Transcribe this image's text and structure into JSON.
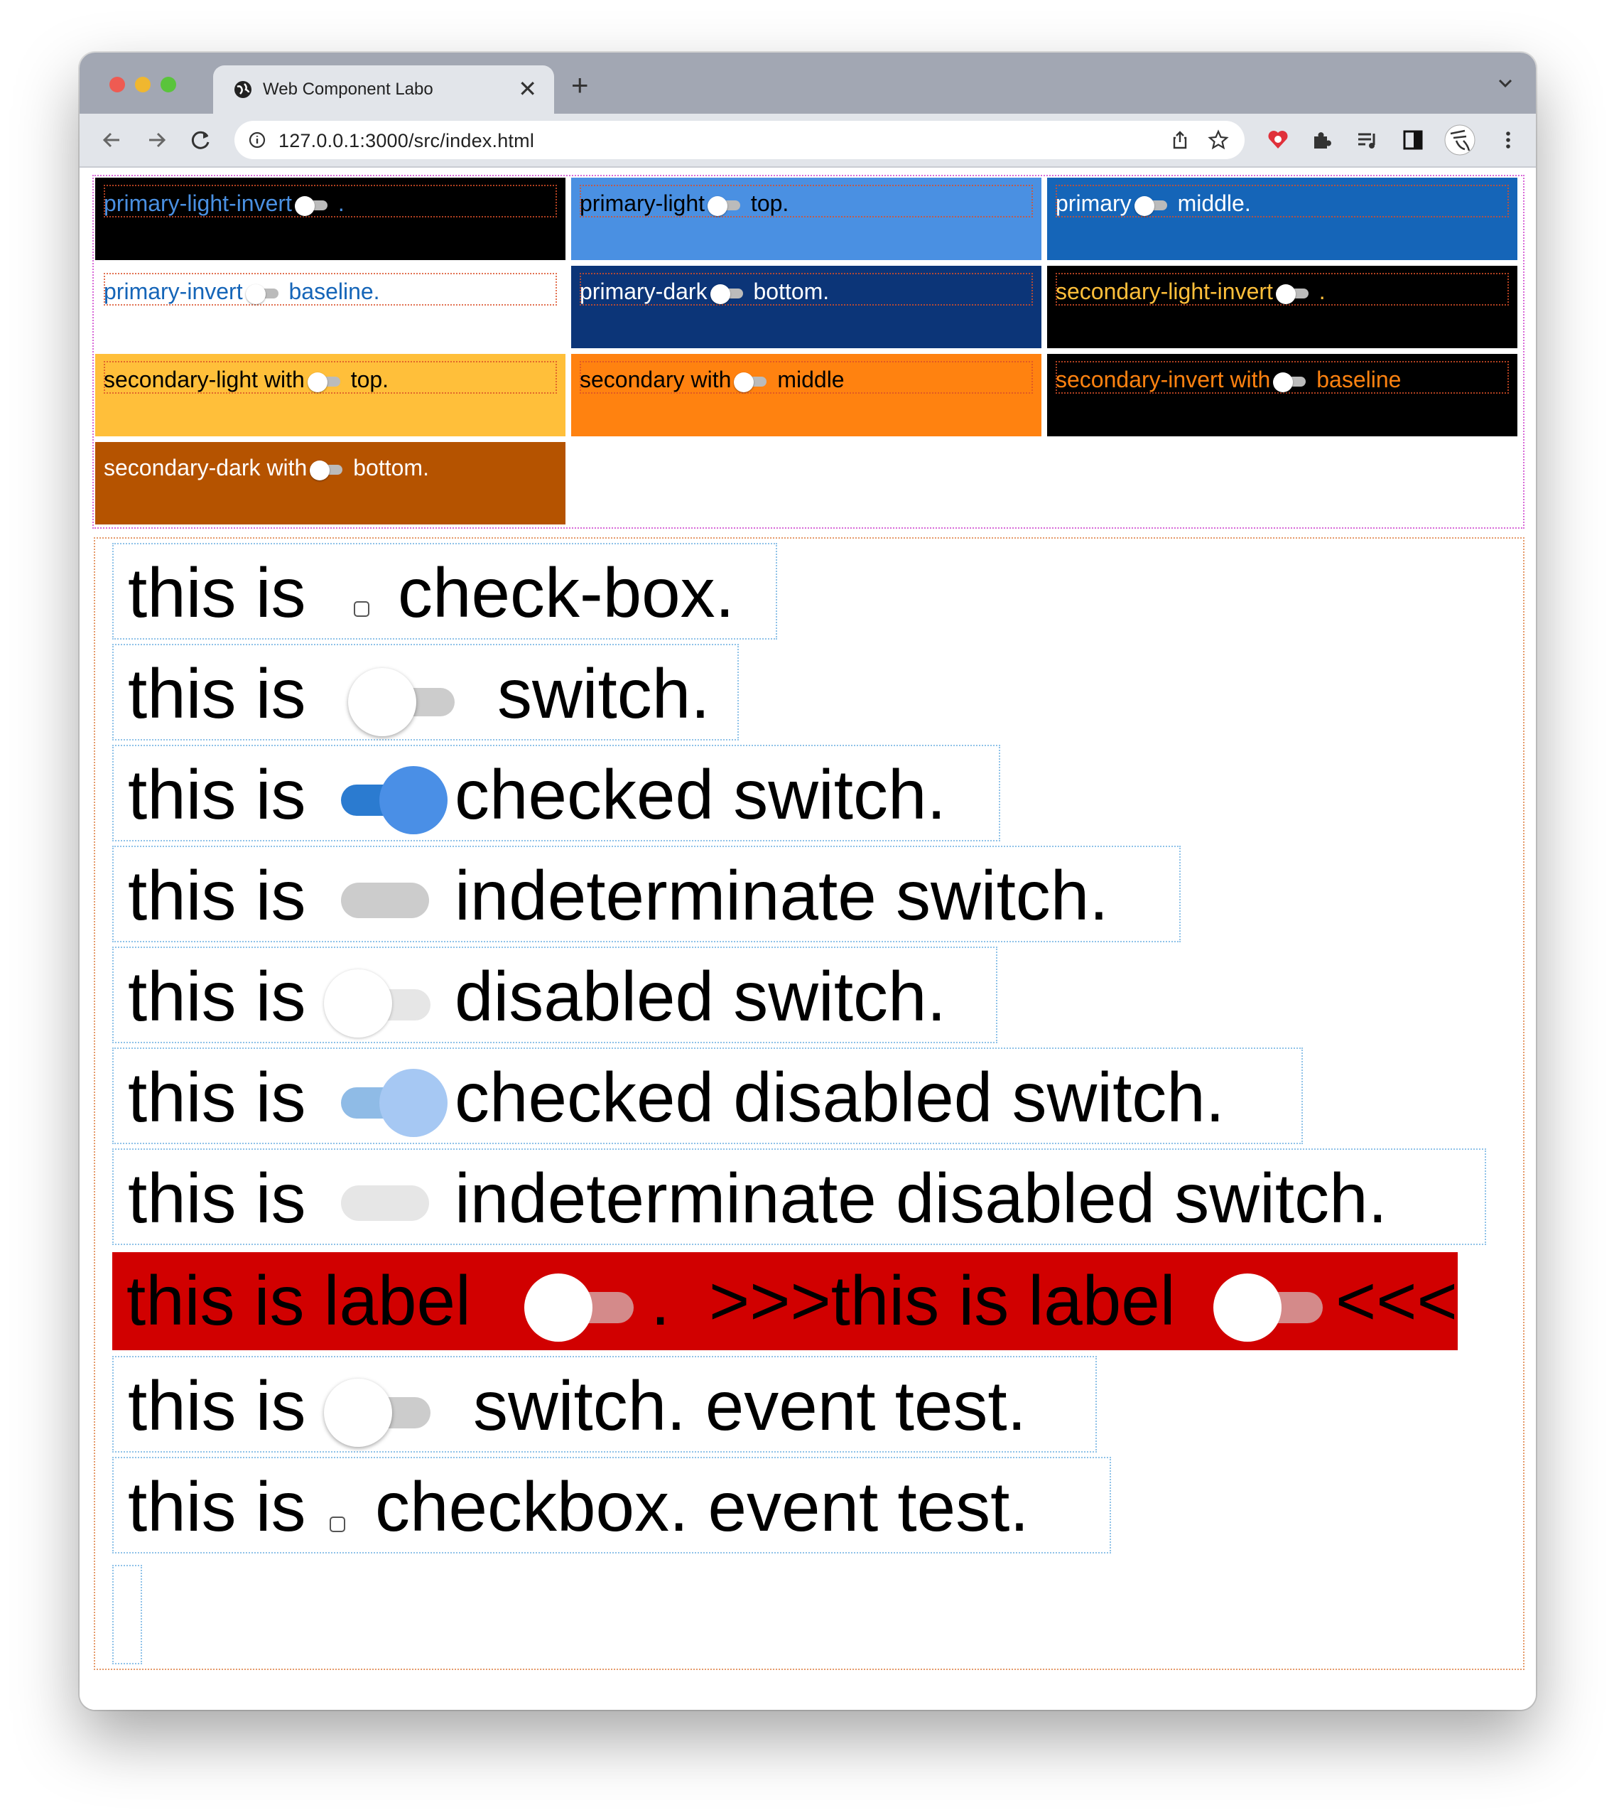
{
  "browser": {
    "tab_title": "Web Component Labo",
    "tab_close": "✕",
    "new_tab": "+",
    "url": "127.0.0.1:3000/src/index.html"
  },
  "grid": [
    {
      "label": "primary-light-invert",
      "suffix": " .",
      "bg": "#000000",
      "fg": "#4a90e2"
    },
    {
      "label": "primary-light",
      "suffix": " top.",
      "bg": "#4a90e2",
      "fg": "#000000"
    },
    {
      "label": "primary",
      "suffix": " middle.",
      "bg": "#1565b8",
      "fg": "#ffffff"
    },
    {
      "label": "primary-invert",
      "suffix": " baseline.",
      "bg": "#ffffff",
      "fg": "#1565b8"
    },
    {
      "label": "primary-dark",
      "suffix": " bottom.",
      "bg": "#0c3578",
      "fg": "#ffffff"
    },
    {
      "label": "secondary-light-invert",
      "suffix": " .",
      "bg": "#000000",
      "fg": "#ffbf3a"
    },
    {
      "label": "secondary-light with",
      "suffix": " top.",
      "bg": "#ffbf3a",
      "fg": "#000000"
    },
    {
      "label": "secondary with",
      "suffix": " middle",
      "bg": "#ff8210",
      "fg": "#000000"
    },
    {
      "label": "secondary-invert with",
      "suffix": " baseline",
      "bg": "#000000",
      "fg": "#ff8210"
    },
    {
      "label": "secondary-dark with",
      "suffix": " bottom.",
      "bg": "#b55300",
      "fg": "#ffffff"
    }
  ],
  "rows": {
    "checkbox": {
      "prefix": "this is",
      "suffix": "check-box."
    },
    "switch": {
      "prefix": "this is",
      "suffix": "switch."
    },
    "checked": {
      "prefix": "this is",
      "suffix": "checked switch."
    },
    "indeterminate": {
      "prefix": "this is",
      "suffix": "indeterminate switch."
    },
    "disabled": {
      "prefix": "this is",
      "suffix": "disabled switch."
    },
    "checked_disabled": {
      "prefix": "this is",
      "suffix": "checked disabled switch."
    },
    "indeterminate_disabled": {
      "prefix": "this is",
      "suffix": "indeterminate disabled switch."
    },
    "label_row": {
      "part1": "this is label",
      "part2": ".",
      "part3": ">>>this is label",
      "part4": "<<<"
    },
    "event_switch": {
      "prefix": "this is",
      "suffix": "switch. event test."
    },
    "event_checkbox": {
      "prefix": "this is",
      "suffix": "checkbox. event test."
    }
  },
  "colors": {
    "switch_track_on": "#2b7bd0",
    "switch_thumb_on": "#4a8fe6",
    "switch_track_off": "#cccccc",
    "label_row_bg": "#d10000"
  }
}
